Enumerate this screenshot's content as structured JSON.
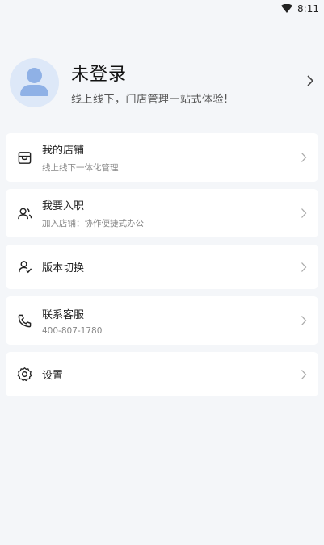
{
  "status_bar": {
    "time": "8:11"
  },
  "profile": {
    "title": "未登录",
    "subtitle": "线上线下，门店管理一站式体验!"
  },
  "menu": [
    {
      "icon": "store-icon",
      "title": "我的店铺",
      "subtitle": "线上线下一体化管理"
    },
    {
      "icon": "join-icon",
      "title": "我要入职",
      "subtitle": "加入店铺：协作便捷式办公"
    },
    {
      "icon": "switch-user-icon",
      "title": "版本切换"
    },
    {
      "icon": "phone-icon",
      "title": "联系客服",
      "subtitle": "400-807-1780"
    },
    {
      "icon": "gear-icon",
      "title": "设置"
    }
  ]
}
